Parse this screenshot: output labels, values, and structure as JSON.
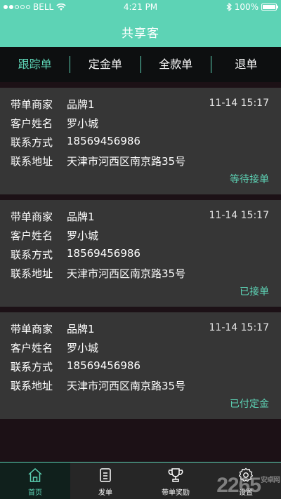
{
  "status_bar": {
    "carrier": "BELL",
    "time": "4:21 PM",
    "battery": "100%",
    "battery_level": 1.0,
    "signal_bars": 2,
    "signal_total": 5
  },
  "header": {
    "title": "共享客"
  },
  "tabs": [
    {
      "label": "跟踪单",
      "active": true
    },
    {
      "label": "定金单",
      "active": false
    },
    {
      "label": "全款单",
      "active": false
    },
    {
      "label": "退单",
      "active": false
    }
  ],
  "field_labels": {
    "merchant": "带单商家",
    "customer": "客户姓名",
    "phone": "联系方式",
    "address": "联系地址"
  },
  "orders": [
    {
      "merchant": "品牌1",
      "customer": "罗小城",
      "phone": "18569456986",
      "address": "天津市河西区南京路35号",
      "time": "11-14  15:17",
      "status": "等待接单"
    },
    {
      "merchant": "品牌1",
      "customer": "罗小城",
      "phone": "18569456986",
      "address": "天津市河西区南京路35号",
      "time": "11-14  15:17",
      "status": "已接单"
    },
    {
      "merchant": "品牌1",
      "customer": "罗小城",
      "phone": "18569456986",
      "address": "天津市河西区南京路35号",
      "time": "11-14  15:17",
      "status": "已付定金"
    }
  ],
  "bottom_nav": [
    {
      "label": "首页",
      "icon": "home-icon",
      "active": true
    },
    {
      "label": "发单",
      "icon": "clipboard-icon",
      "active": false
    },
    {
      "label": "带单奖励",
      "icon": "trophy-icon",
      "active": false
    },
    {
      "label": "设置",
      "icon": "gear-icon",
      "active": false
    }
  ],
  "watermark": {
    "text": "2265",
    "subtext": "安卓网"
  },
  "colors": {
    "accent": "#5dd3b5",
    "card": "#363636",
    "background": "#1c1116"
  }
}
